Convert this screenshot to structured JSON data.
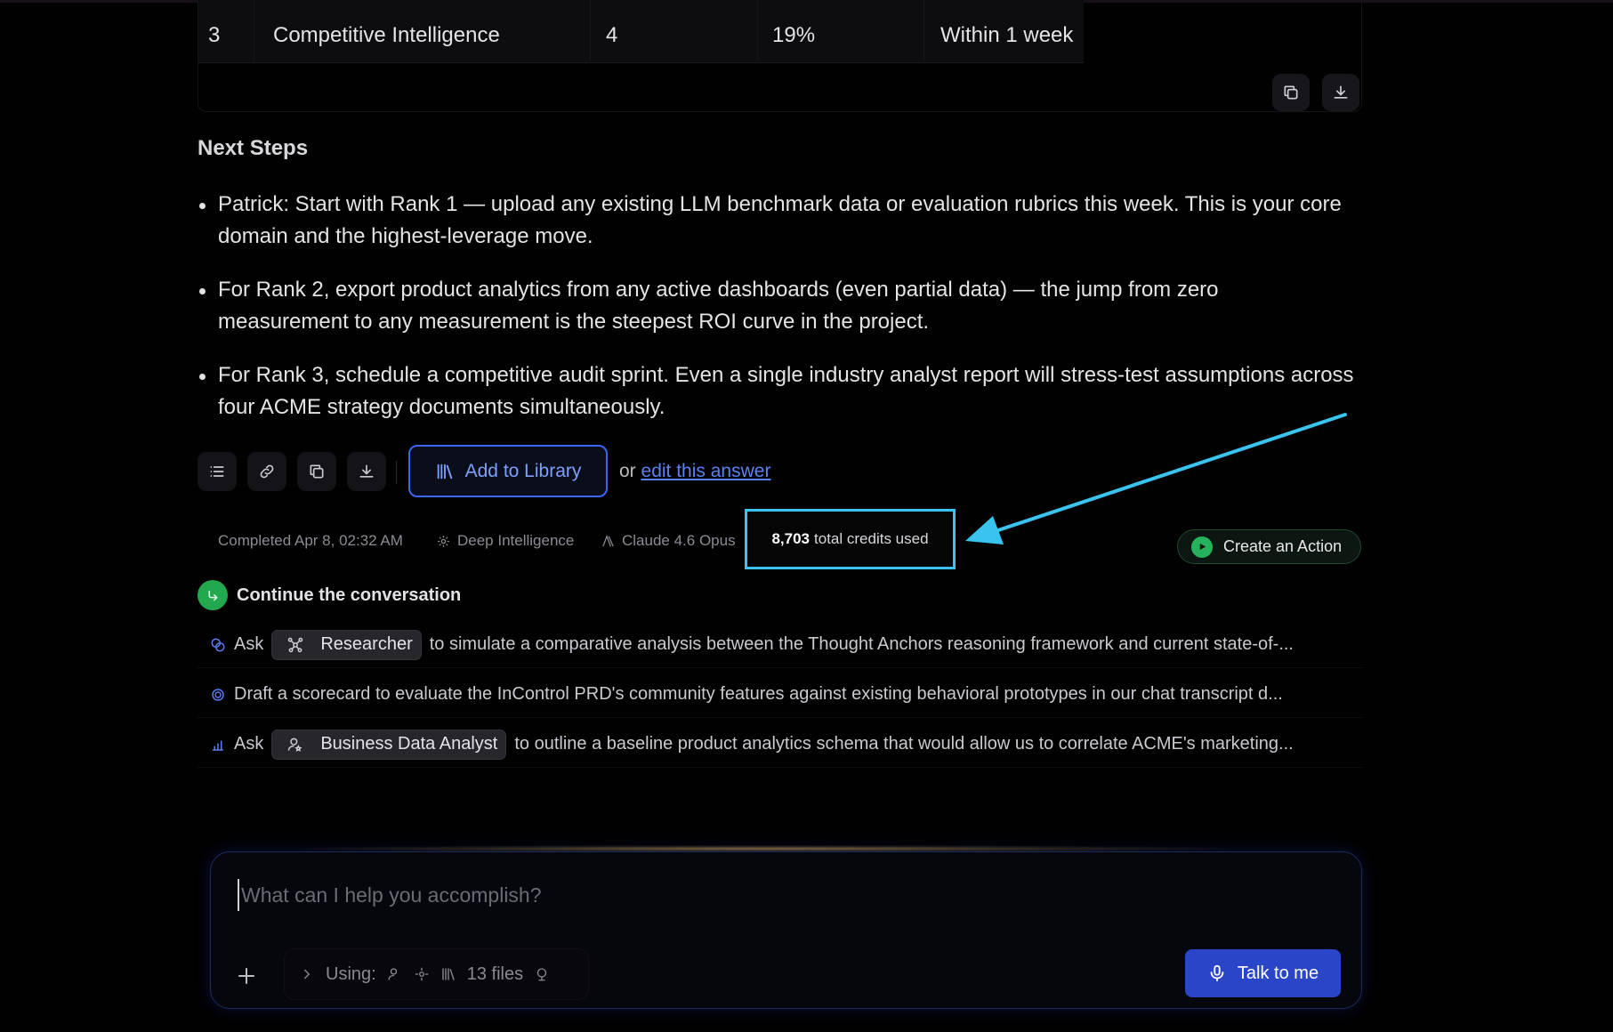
{
  "table": {
    "row": [
      "3",
      "Competitive Intelligence",
      "4",
      "19%",
      "Within 1 week"
    ],
    "copy_icon": "copy-icon",
    "download_icon": "download-icon"
  },
  "next_steps": {
    "title": "Next Steps",
    "items": [
      "Patrick: Start with Rank 1 — upload any existing LLM benchmark data or evaluation rubrics this week. This is your core domain and the highest-leverage move.",
      "For Rank 2, export product analytics from any active dashboards (even partial data) — the jump from zero measurement to any measurement is the steepest ROI curve in the project.",
      "For Rank 3, schedule a competitive audit sprint. Even a single industry analyst report will stress-test assumptions across four ACME strategy documents simultaneously."
    ]
  },
  "actions": {
    "add_to_library": "Add to Library",
    "or": "or",
    "edit_link": "edit this answer"
  },
  "meta": {
    "completed": "Completed Apr 8, 02:32 AM",
    "mode": "Deep Intelligence",
    "model": "Claude 4.6 Opus",
    "credits_value": "8,703",
    "credits_label": "total credits used"
  },
  "create_action": "Create an Action",
  "continue": {
    "title": "Continue the conversation",
    "suggestions": [
      {
        "prefix": "Ask",
        "agent": "Researcher",
        "text": "to simulate a comparative analysis between the Thought Anchors reasoning framework and current state-of-..."
      },
      {
        "prefix": "",
        "agent": "",
        "text": "Draft a scorecard to evaluate the InControl PRD's community features against existing behavioral prototypes in our chat transcript d..."
      },
      {
        "prefix": "Ask",
        "agent": "Business Data Analyst",
        "text": "to outline a baseline product analytics schema that would allow us to correlate ACME's marketing..."
      }
    ]
  },
  "composer": {
    "placeholder": "What can I help you accomplish?",
    "using_label": "Using:",
    "files": "13 files",
    "talk_button": "Talk to me"
  },
  "colors": {
    "accent_blue": "#3b66f0",
    "highlight_cyan": "#39c4ef",
    "green": "#26b25c"
  }
}
